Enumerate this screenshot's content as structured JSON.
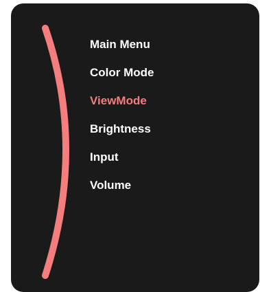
{
  "osd": {
    "accent_color": "#f47d7d",
    "background_color": "#1b1a1a",
    "selected_item": "ViewMode",
    "items": [
      {
        "label": "Main Menu",
        "active": false
      },
      {
        "label": "Color Mode",
        "active": false
      },
      {
        "label": "ViewMode",
        "active": true
      },
      {
        "label": "Brightness",
        "active": false
      },
      {
        "label": "Input",
        "active": false
      },
      {
        "label": "Volume",
        "active": false
      }
    ]
  }
}
